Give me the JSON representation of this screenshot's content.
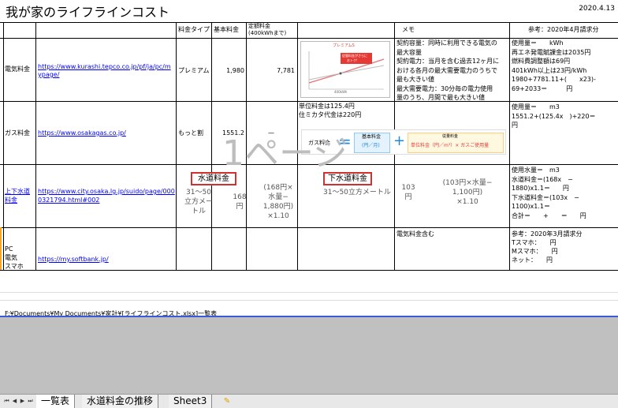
{
  "sheet": {
    "title": "我が家のライフラインコスト",
    "date": "2020.4.13",
    "headers": {
      "plan_type": "料金タイプ",
      "base_fee": "基本料金",
      "fixed_fee": "定額料金",
      "fixed_fee_sub": "(400kWhまで)",
      "memo": "メモ",
      "reference": "参考：2020年4月請求分"
    },
    "rows": {
      "electric": {
        "label": "電気料金",
        "url1": "https://www.kurashi.tepco.co.jp/pf/ja/pc/m",
        "url2": "ypage/",
        "plan": "プレミアム",
        "base": "1,980",
        "fixed": "7,781",
        "memo": [
          "契約容量：同時に利用できる電気の",
          "最大容量",
          "契約電力：当月を含む過去12ヶ月に",
          "おける各月の最大需要電力のうちで",
          "最も大きい値",
          "最大需要電力：30分毎の電力使用",
          "量のうち、月間で最も大きい値"
        ],
        "ref": [
          "使用量＝　　kWh",
          "再エネ発電賦課金は2035円",
          "燃料費調整額は69円",
          "401kWh以上は23円/kWh",
          "1980+7781.11+(　　x23)-",
          "69+2033＝　　　円"
        ],
        "chart_label": "プレミアムS",
        "chart_badge": "従量料金がさらに",
        "chart_badge2": "おトク!",
        "chart_axis": "400kWh"
      },
      "gas": {
        "label": "ガス料金",
        "url": "https://www.osakagas.co.jp/",
        "plan": "もっと割",
        "base": "1551.2",
        "fixed": "—",
        "memo": [
          "単位料金は125.4円",
          "住ミカタ代金は220円"
        ],
        "ref": [
          "使用量＝　　m3",
          "1551.2+(125.4x　)+220＝",
          "円"
        ],
        "formula": {
          "left": "ガス料金",
          "eq": "=",
          "base_title": "基本料金",
          "base_unit": "(円／月)",
          "plus": "+",
          "usage_title": "従量料金",
          "usage_body": "単位料金（円／m³）× ガスご使用量"
        }
      },
      "water": {
        "label1": "上下水道",
        "label2": "料金",
        "url1": "https://www.city.osaka.lg.jp/suido/page/000",
        "url2": "0321794.html#002",
        "water_title": "水道料金",
        "water_range": [
          "31〜50",
          "立方メー",
          "トル"
        ],
        "water_base": [
          "168",
          "円"
        ],
        "water_formula": [
          "(168円×",
          "水量−",
          "1,880円)",
          "×1.10"
        ],
        "sewer_title": "下水道料金",
        "sewer_range": "31〜50立方メートル",
        "sewer_base": [
          "103",
          "円"
        ],
        "sewer_formula": [
          "(103円×水量−",
          "1,100円)",
          "×1.10"
        ],
        "ref": [
          "使用水量＝　m3",
          "水道料金＝(168x　−",
          "1880)x1.1＝　　円",
          "下水道料金＝(103x　−",
          "1100)x1.1＝",
          "合計＝　　+　　＝　　円"
        ]
      },
      "pc": {
        "label": [
          "PC",
          "電気",
          "スマホ"
        ],
        "url": "https://my.softbank.jp/",
        "memo": "電気料金含む",
        "ref": [
          "参考：2020年3月請求分",
          "Tスマホ：　　円",
          "Mスマホ：　　円",
          "ネット：　　円"
        ]
      }
    },
    "watermark": "1ページ",
    "path": "F:¥Documents¥My Documents¥家計¥[ライフラインコスト.xlsx]一覧表"
  },
  "tabs": [
    "一覧表",
    "水道料金の推移",
    "Sheet3"
  ],
  "nav": [
    "⏮",
    "◀",
    "▶",
    "⏭"
  ]
}
